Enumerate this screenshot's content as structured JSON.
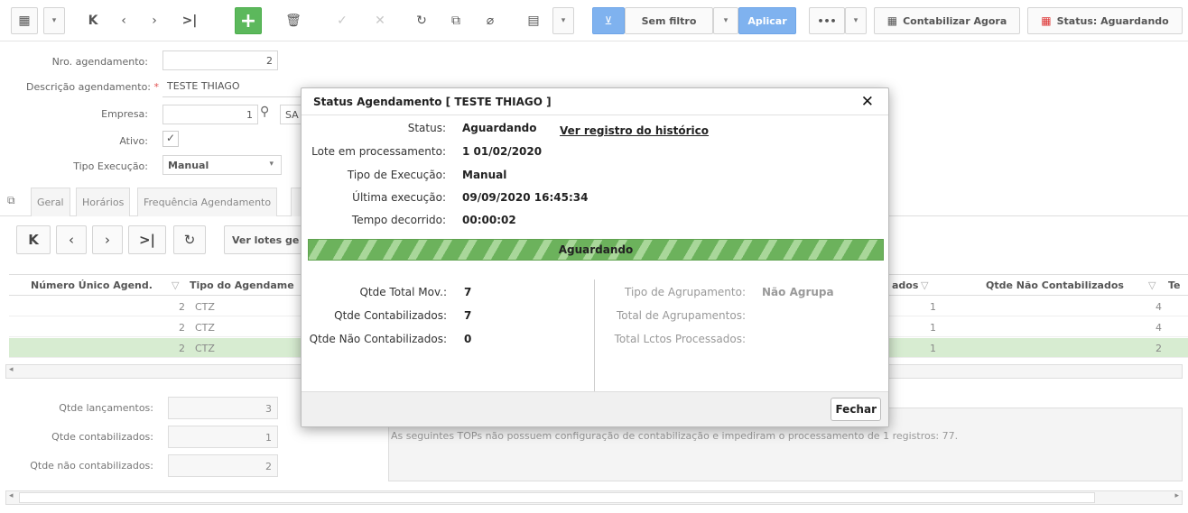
{
  "toolbar": {
    "sem_filtro": "Sem filtro",
    "aplicar": "Aplicar",
    "more": "•••",
    "contabilizar": "Contabilizar Agora",
    "status": "Status: Aguardando"
  },
  "form": {
    "nro_label": "Nro. agendamento:",
    "nro_value": "2",
    "descricao_label": "Descrição agendamento:",
    "descricao_value": "TESTE THIAGO",
    "empresa_label": "Empresa:",
    "empresa_value": "1",
    "empresa_name": "SA",
    "ativo_label": "Ativo:",
    "tipo_label": "Tipo Execução:",
    "tipo_value": "Manual"
  },
  "tabs": [
    "Geral",
    "Horários",
    "Frequência Agendamento"
  ],
  "grid": {
    "ver_lotes": "Ver lotes ge",
    "headers": {
      "numero": "Número Único Agend.",
      "tipo": "Tipo do Agendame",
      "contab": "ados",
      "nao_contab": "Qtde  Não Contabilizados",
      "te": "Te"
    },
    "rows": [
      {
        "numero": "2",
        "tipo": "CTZ",
        "contab": "1",
        "nao": "4"
      },
      {
        "numero": "2",
        "tipo": "CTZ",
        "contab": "1",
        "nao": "4"
      },
      {
        "numero": "2",
        "tipo": "CTZ",
        "contab": "1",
        "nao": "2"
      }
    ]
  },
  "bottom": {
    "lanc_label": "Qtde lançamentos:",
    "lanc_value": "3",
    "contab_label": "Qtde contabilizados:",
    "contab_value": "1",
    "nao_label": "Qtde não contabilizados:",
    "nao_value": "2",
    "message": "As seguintes TOPs não possuem configuração de contabilização e impediram o processamento de 1 registros: 77."
  },
  "dialog": {
    "title": "Status Agendamento [ TESTE THIAGO ]",
    "status_label": "Status:",
    "status_value": "Aguardando",
    "link": "Ver registro do histórico",
    "lote_label": "Lote em processamento:",
    "lote_value": "1 01/02/2020",
    "tipo_label": "Tipo de Execução:",
    "tipo_value": "Manual",
    "ultima_label": "Última execução:",
    "ultima_value": "09/09/2020 16:45:34",
    "tempo_label": "Tempo decorrido:",
    "tempo_value": "00:00:02",
    "progress_text": "Aguardando",
    "progress": 1.0,
    "total_mov_label": "Qtde Total Mov.:",
    "total_mov_value": "7",
    "contab_label": "Qtde Contabilizados:",
    "contab_value": "7",
    "nao_contab_label": "Qtde Não Contabilizados:",
    "nao_contab_value": "0",
    "agrup_label": "Tipo de Agrupamento:",
    "agrup_value": "Não Agrupa",
    "total_agrup_label": "Total de Agrupamentos:",
    "total_lctos_label": "Total Lctos Processados:",
    "fechar": "Fechar"
  }
}
